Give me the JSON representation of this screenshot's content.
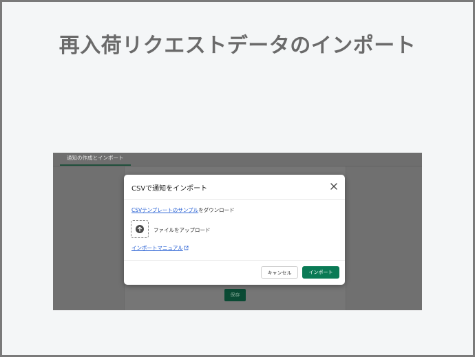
{
  "slide": {
    "title": "再入荷リクエストデータのインポート"
  },
  "background": {
    "tab_label": "通知の作成とインポート",
    "save_label": "保存"
  },
  "modal": {
    "title": "CSVで通知をインポート",
    "close_icon": "close-icon",
    "download": {
      "link_text": "CSVテンプレートのサンプル",
      "suffix_text": "をダウンロード"
    },
    "upload": {
      "icon": "upload-icon",
      "label": "ファイルをアップロード"
    },
    "manual_link": "インポートマニュアル",
    "manual_icon": "external-link-icon",
    "cancel_label": "キャンセル",
    "import_label": "インポート"
  },
  "colors": {
    "primary": "#0a7a55",
    "link": "#2a62d4",
    "title_text": "#6a6a6a",
    "overlay": "#707070"
  }
}
